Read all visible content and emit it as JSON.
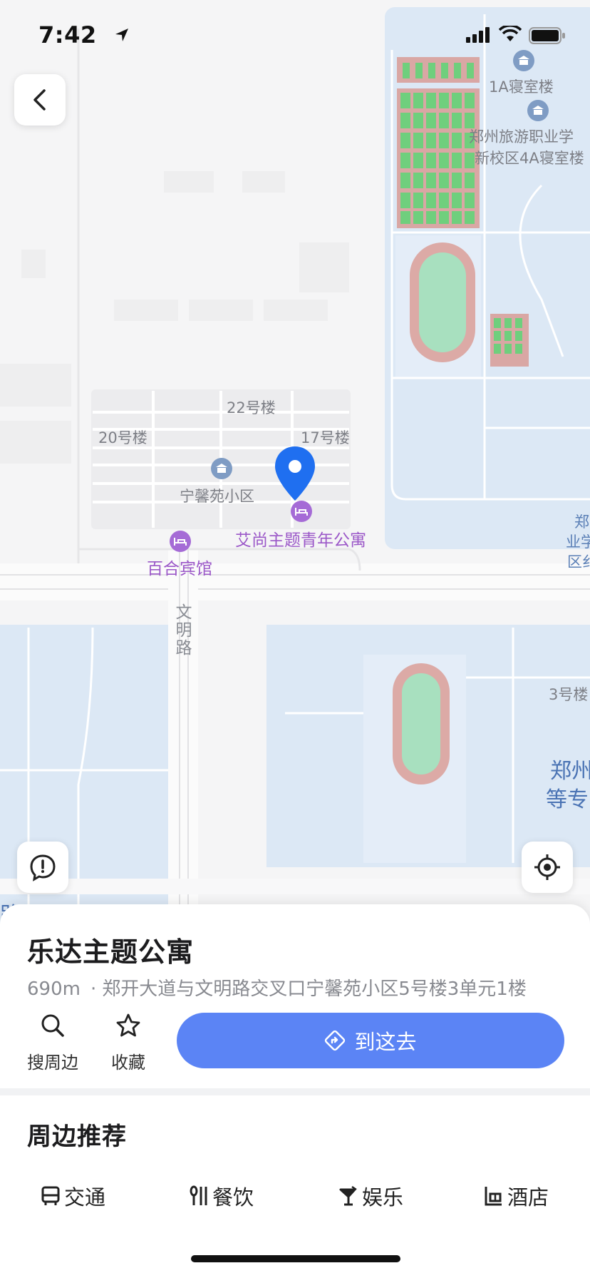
{
  "status_bar": {
    "time": "7:42"
  },
  "map": {
    "labels": {
      "dorm_1a": "1A寝室楼",
      "school_line1": "郑州旅游职业学",
      "school_line2": "新校区4A寝室楼",
      "bldg_22": "22号楼",
      "bldg_20": "20号楼",
      "bldg_17": "17号楼",
      "community": "宁馨苑小区",
      "poi_apartment": "艾尚主题青年公寓",
      "poi_hotel": "百合宾馆",
      "road_wenming": "文明路",
      "bldg_3": "3号楼",
      "right_edge_1": "郑",
      "right_edge_2": "业学",
      "right_edge_3": "区纟",
      "right_big_1": "郑州",
      "right_big_2": "等专",
      "bottom_left": "路职"
    }
  },
  "place": {
    "title": "乐达主题公寓",
    "distance": "690m",
    "separator": "·",
    "address": "郑开大道与文明路交叉口宁馨苑小区5号楼3单元1楼"
  },
  "actions": {
    "search_nearby": "搜周边",
    "favorite": "收藏",
    "go_here": "到这去"
  },
  "nearby": {
    "title": "周边推荐",
    "categories": [
      {
        "label": "交通",
        "icon": "bus-icon"
      },
      {
        "label": "餐饮",
        "icon": "cutlery-icon"
      },
      {
        "label": "娱乐",
        "icon": "cocktail-icon"
      },
      {
        "label": "酒店",
        "icon": "hotel-icon"
      }
    ]
  },
  "colors": {
    "accent": "#5b84f5",
    "pin": "#1f6ff0",
    "poi": "#a56bd6",
    "campus": "#dde8f5"
  }
}
